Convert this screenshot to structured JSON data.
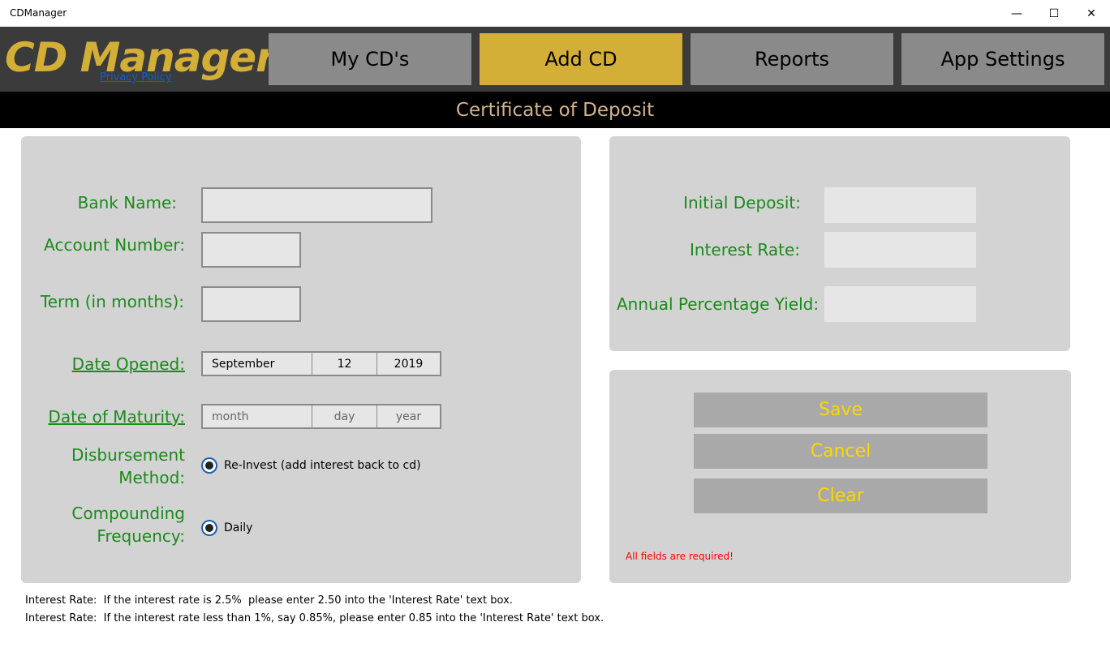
{
  "window": {
    "title": "CDManager",
    "minimize_glyph": "—",
    "maximize_glyph": "☐",
    "close_glyph": "✕"
  },
  "header": {
    "logo": "CD Manager",
    "privacy_link": "Privacy Policy",
    "tabs": [
      {
        "label": "My CD's",
        "active": false
      },
      {
        "label": "Add CD",
        "active": true
      },
      {
        "label": "Reports",
        "active": false
      },
      {
        "label": "App Settings",
        "active": false
      }
    ],
    "accent_color": "#d4af37",
    "banner": "Certificate of Deposit"
  },
  "form": {
    "bank_name_label": "Bank Name:",
    "bank_name_value": "",
    "account_number_label": "Account Number:",
    "account_number_value": "",
    "term_label": "Term (in months):",
    "term_value": "",
    "date_opened_label": "Date Opened:",
    "date_opened": {
      "month": "September",
      "day": "12",
      "year": "2019"
    },
    "date_maturity_label": "Date of Maturity:",
    "date_maturity_placeholder": {
      "month": "month",
      "day": "day",
      "year": "year"
    },
    "disbursement_label_1": "Disbursement",
    "disbursement_label_2": "Method:",
    "disbursement_option": "Re-Invest (add interest back to cd)",
    "compounding_label_1": "Compounding",
    "compounding_label_2": "Frequency:",
    "compounding_option": "Daily"
  },
  "financials": {
    "initial_deposit_label": "Initial Deposit:",
    "initial_deposit_value": "",
    "interest_rate_label": "Interest Rate:",
    "interest_rate_value": "",
    "apy_label": "Annual Percentage Yield:",
    "apy_value": ""
  },
  "actions": {
    "save": "Save",
    "cancel": "Cancel",
    "clear": "Clear",
    "required_msg": "All fields are required!"
  },
  "notes": [
    "Interest Rate:  If the interest rate is 2.5%  please enter 2.50 into the 'Interest Rate' text box.",
    "Interest Rate:  If the interest rate less than 1%, say 0.85%, please enter 0.85 into the 'Interest Rate' text box."
  ]
}
